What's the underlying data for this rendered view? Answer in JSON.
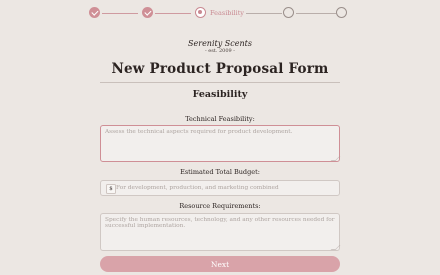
{
  "stepper": {
    "current_label": "Feasibility",
    "steps": [
      "done",
      "done",
      "current",
      "todo",
      "todo"
    ],
    "accent": "#cf8f96"
  },
  "brand": {
    "name": "Serenity Scents",
    "established": "- est. 2009 -"
  },
  "form": {
    "title": "New Product Proposal Form",
    "section_title": "Feasibility",
    "technical": {
      "label": "Technical Feasibility:",
      "placeholder": "Assess the technical aspects required for product development.",
      "value": ""
    },
    "budget": {
      "label": "Estimated Total Budget:",
      "prefix": "$",
      "placeholder": "For development, production, and marketing combined",
      "value": ""
    },
    "resources": {
      "label": "Resource Requirements:",
      "placeholder": "Specify the human resources, technology, and any other resources needed for successful implementation.",
      "value": ""
    },
    "next_label": "Next"
  }
}
